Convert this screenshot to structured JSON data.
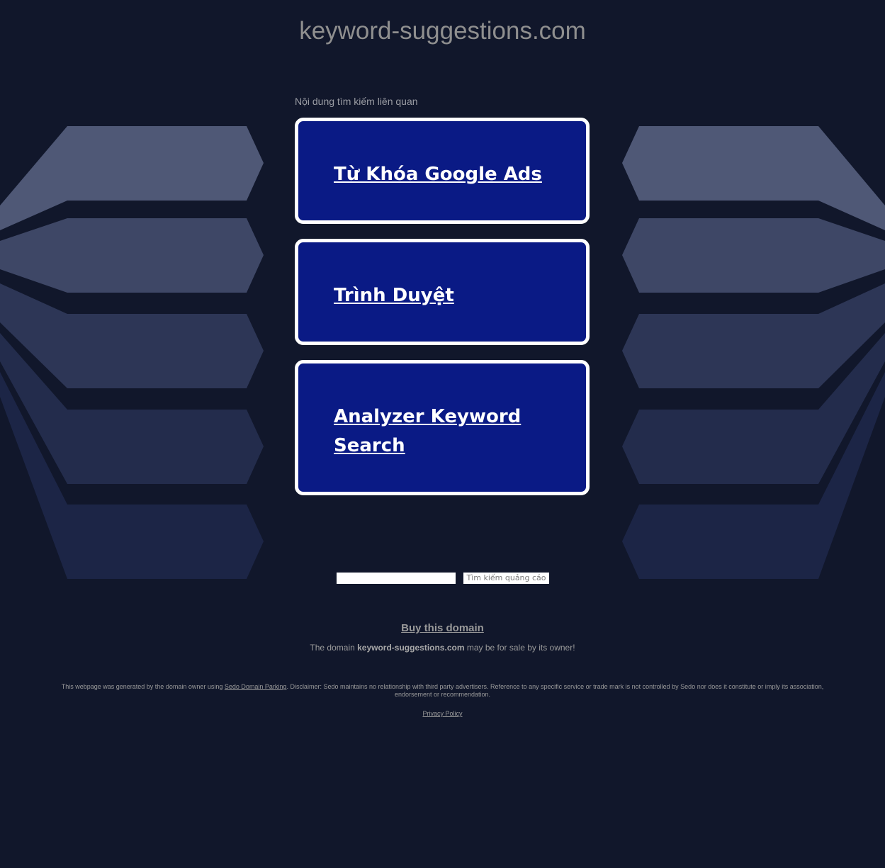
{
  "page": {
    "domain": "keyword-suggestions.com",
    "related_label": "Nội dung tìm kiếm liên quan"
  },
  "ads": [
    {
      "label": "Từ Khóa Google Ads"
    },
    {
      "label": "Trình Duyệt"
    },
    {
      "label": "Analyzer Keyword Search"
    }
  ],
  "search": {
    "input_value": "",
    "button_label": "Tìm kiếm quảng cáo"
  },
  "sale": {
    "buy_label": "Buy this domain",
    "prefix": "The domain ",
    "domain_bold": "keyword-suggestions.com",
    "suffix": " may be for sale by its owner!"
  },
  "footer": {
    "disclaimer_prefix": "This webpage was generated by the domain owner using ",
    "sedo_link": "Sedo Domain Parking",
    "disclaimer_suffix": ". Disclaimer: Sedo maintains no relationship with third party advertisers. Reference to any specific service or trade mark is not controlled by Sedo nor does it constitute or imply its association, endorsement or recommendation.",
    "privacy_label": "Privacy Policy"
  },
  "colors": {
    "background": "#11172b",
    "ad_box": "#0a1a85",
    "ad_border": "#ffffff",
    "decor_light": "#4f5876",
    "decor_dark": "#1a2446"
  }
}
